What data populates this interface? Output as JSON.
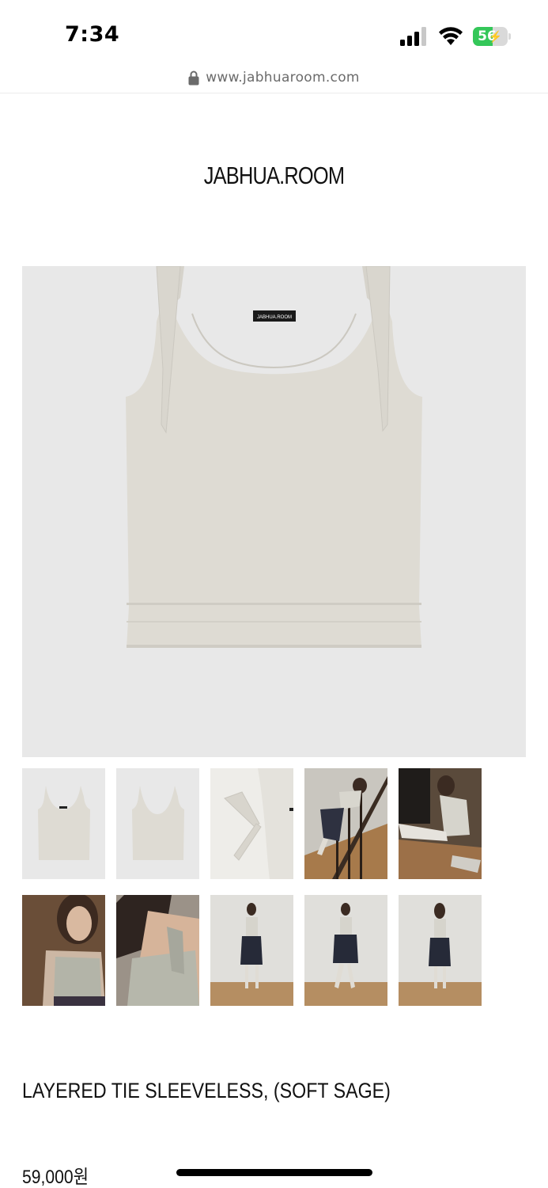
{
  "status_bar": {
    "time": "7:34",
    "battery_percent": "56",
    "battery_level": 0.56,
    "icons": [
      "cellular-signal-icon",
      "wifi-icon",
      "battery-charging-icon"
    ]
  },
  "browser": {
    "url": "www.jabhuaroom.com",
    "icon": "lock-icon"
  },
  "brand": {
    "logo_text": "JABHUA.ROOM"
  },
  "product": {
    "main_image_label": "JABHUA.ROOM",
    "name": "LAYERED TIE SLEEVELESS, (SOFT SAGE)",
    "price": "59,000원",
    "thumbnails": [
      "thumbnail-front-flat",
      "thumbnail-back-flat",
      "thumbnail-tie-detail",
      "thumbnail-stairs-model",
      "thumbnail-seated-model",
      "thumbnail-closeup-front",
      "thumbnail-closeup-shoulder",
      "thumbnail-full-front",
      "thumbnail-full-side",
      "thumbnail-full-back"
    ]
  },
  "colors": {
    "image_background": "#e8e8e8",
    "garment": "#dedbd3",
    "battery_green": "#34c759",
    "url_gray": "#6b6b6b"
  }
}
